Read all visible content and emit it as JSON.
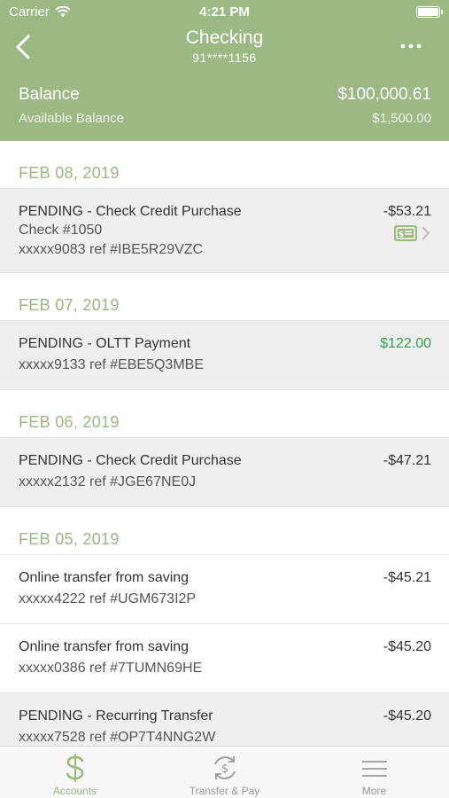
{
  "status_bar": {
    "carrier": "Carrier",
    "time": "4:21 PM"
  },
  "nav": {
    "title": "Checking",
    "subtitle": "91****1156",
    "back_icon": "chevron-left-icon",
    "more_icon": "more-dots-icon"
  },
  "balance": {
    "label": "Balance",
    "value": "$100,000.61",
    "available_label": "Available Balance",
    "available_value": "$1,500.00"
  },
  "colors": {
    "header_bg": "#9cb883",
    "accent": "#9cb883",
    "credit": "#2ea04f",
    "pending_bg": "#efefef"
  },
  "groups": [
    {
      "date": "FEB 08, 2019",
      "transactions": [
        {
          "title": "PENDING - Check Credit Purchase",
          "sub1": "Check #1050",
          "sub2": "xxxxx9083 ref #IBE5R29VZC",
          "amount": "-$53.21",
          "has_check_image": true
        }
      ]
    },
    {
      "date": "FEB 07, 2019",
      "transactions": [
        {
          "title": "PENDING - OLTT Payment",
          "sub1": "xxxxx9133 ref #EBE5Q3MBE",
          "amount": "$122.00"
        }
      ]
    },
    {
      "date": "FEB 06, 2019",
      "transactions": [
        {
          "title": "PENDING - Check Credit Purchase",
          "sub1": "xxxxx2132 ref #JGE67NE0J",
          "amount": "-$47.21"
        }
      ]
    },
    {
      "date": "FEB 05, 2019",
      "transactions": [
        {
          "title": "Online transfer from saving",
          "sub1": "xxxxx4222 ref #UGM673I2P",
          "amount": "-$45.21"
        },
        {
          "title": "Online transfer from saving",
          "sub1": "xxxxx0386 ref #7TUMN69HE",
          "amount": "-$45.20"
        },
        {
          "title": "PENDING - Recurring Transfer",
          "sub1": "xxxxx7528 ref #OP7T4NNG2W",
          "amount": "-$45.20"
        }
      ]
    }
  ],
  "tabbar": {
    "tabs": [
      {
        "label": "Accounts",
        "icon": "dollar-icon",
        "active": true
      },
      {
        "label": "Transfer & Pay",
        "icon": "transfer-pay-icon",
        "active": false
      },
      {
        "label": "More",
        "icon": "menu-icon",
        "active": false
      }
    ]
  }
}
